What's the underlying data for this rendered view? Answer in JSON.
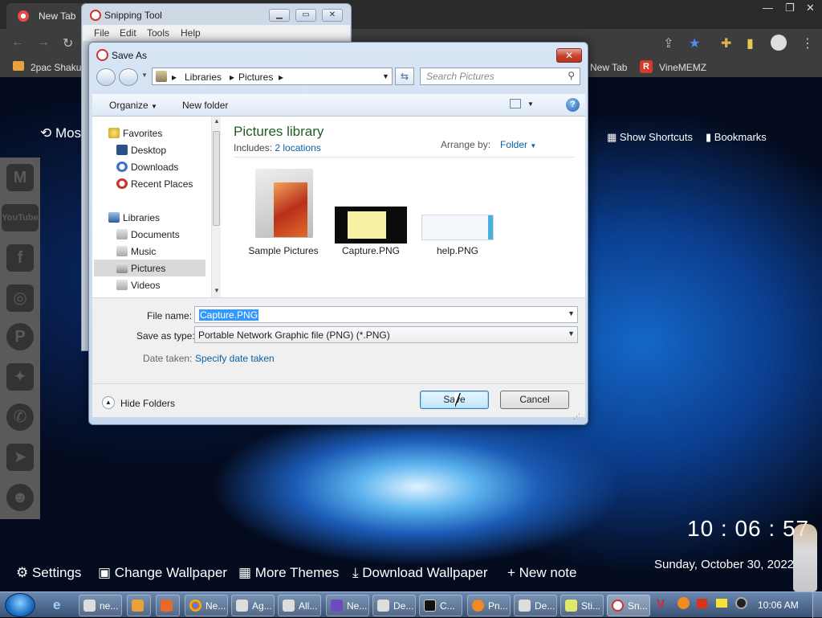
{
  "browser": {
    "tab_title": "New Tab",
    "bookmarks": [
      "2pac Shakur",
      "New Tab",
      "VineMEMZ"
    ]
  },
  "newtab": {
    "most_visited": "Mos",
    "show_shortcuts": "Show Shortcuts",
    "bookmarks": "Bookmarks",
    "bottom_items": [
      "Settings",
      "Change Wallpaper",
      "More Themes",
      "Download Wallpaper",
      "+ New note"
    ],
    "clock": "10 : 06 : 57",
    "date": "Sunday, October 30, 2022",
    "social": [
      "Gmail",
      "YouTube",
      "Facebook",
      "Instagram",
      "Pinterest",
      "Twitter",
      "WhatsApp",
      "Telegram",
      "Reddit"
    ]
  },
  "snipping": {
    "title": "Snipping Tool",
    "menu": [
      "File",
      "Edit",
      "Tools",
      "Help"
    ]
  },
  "dialog": {
    "title": "Save As",
    "breadcrumb": [
      "Libraries",
      "Pictures"
    ],
    "search_placeholder": "Search Pictures",
    "organize": "Organize",
    "new_folder": "New folder",
    "nav": {
      "favorites": "Favorites",
      "favorites_items": [
        "Desktop",
        "Downloads",
        "Recent Places"
      ],
      "libraries": "Libraries",
      "libraries_items": [
        "Documents",
        "Music",
        "Pictures",
        "Videos"
      ]
    },
    "library_title": "Pictures library",
    "includes_label": "Includes:",
    "includes_link": "2 locations",
    "arrange_label": "Arrange by:",
    "arrange_value": "Folder",
    "files": [
      "Sample Pictures",
      "Capture.PNG",
      "help.PNG"
    ],
    "file_name_label": "File name:",
    "file_name_value": "Capture.PNG",
    "save_type_label": "Save as type:",
    "save_type_value": "Portable Network Graphic file (PNG) (*.PNG)",
    "date_taken_label": "Date taken:",
    "date_taken_link": "Specify date taken",
    "hide_folders": "Hide Folders",
    "save": "Save",
    "cancel": "Cancel"
  },
  "taskbar": {
    "tasks": [
      "ne...",
      "",
      "",
      "Ne...",
      "Ag...",
      "All...",
      "Ne...",
      "De...",
      "C...",
      "Pn...",
      "De...",
      "Sti...",
      "Sn..."
    ],
    "time": "10:06 AM"
  }
}
